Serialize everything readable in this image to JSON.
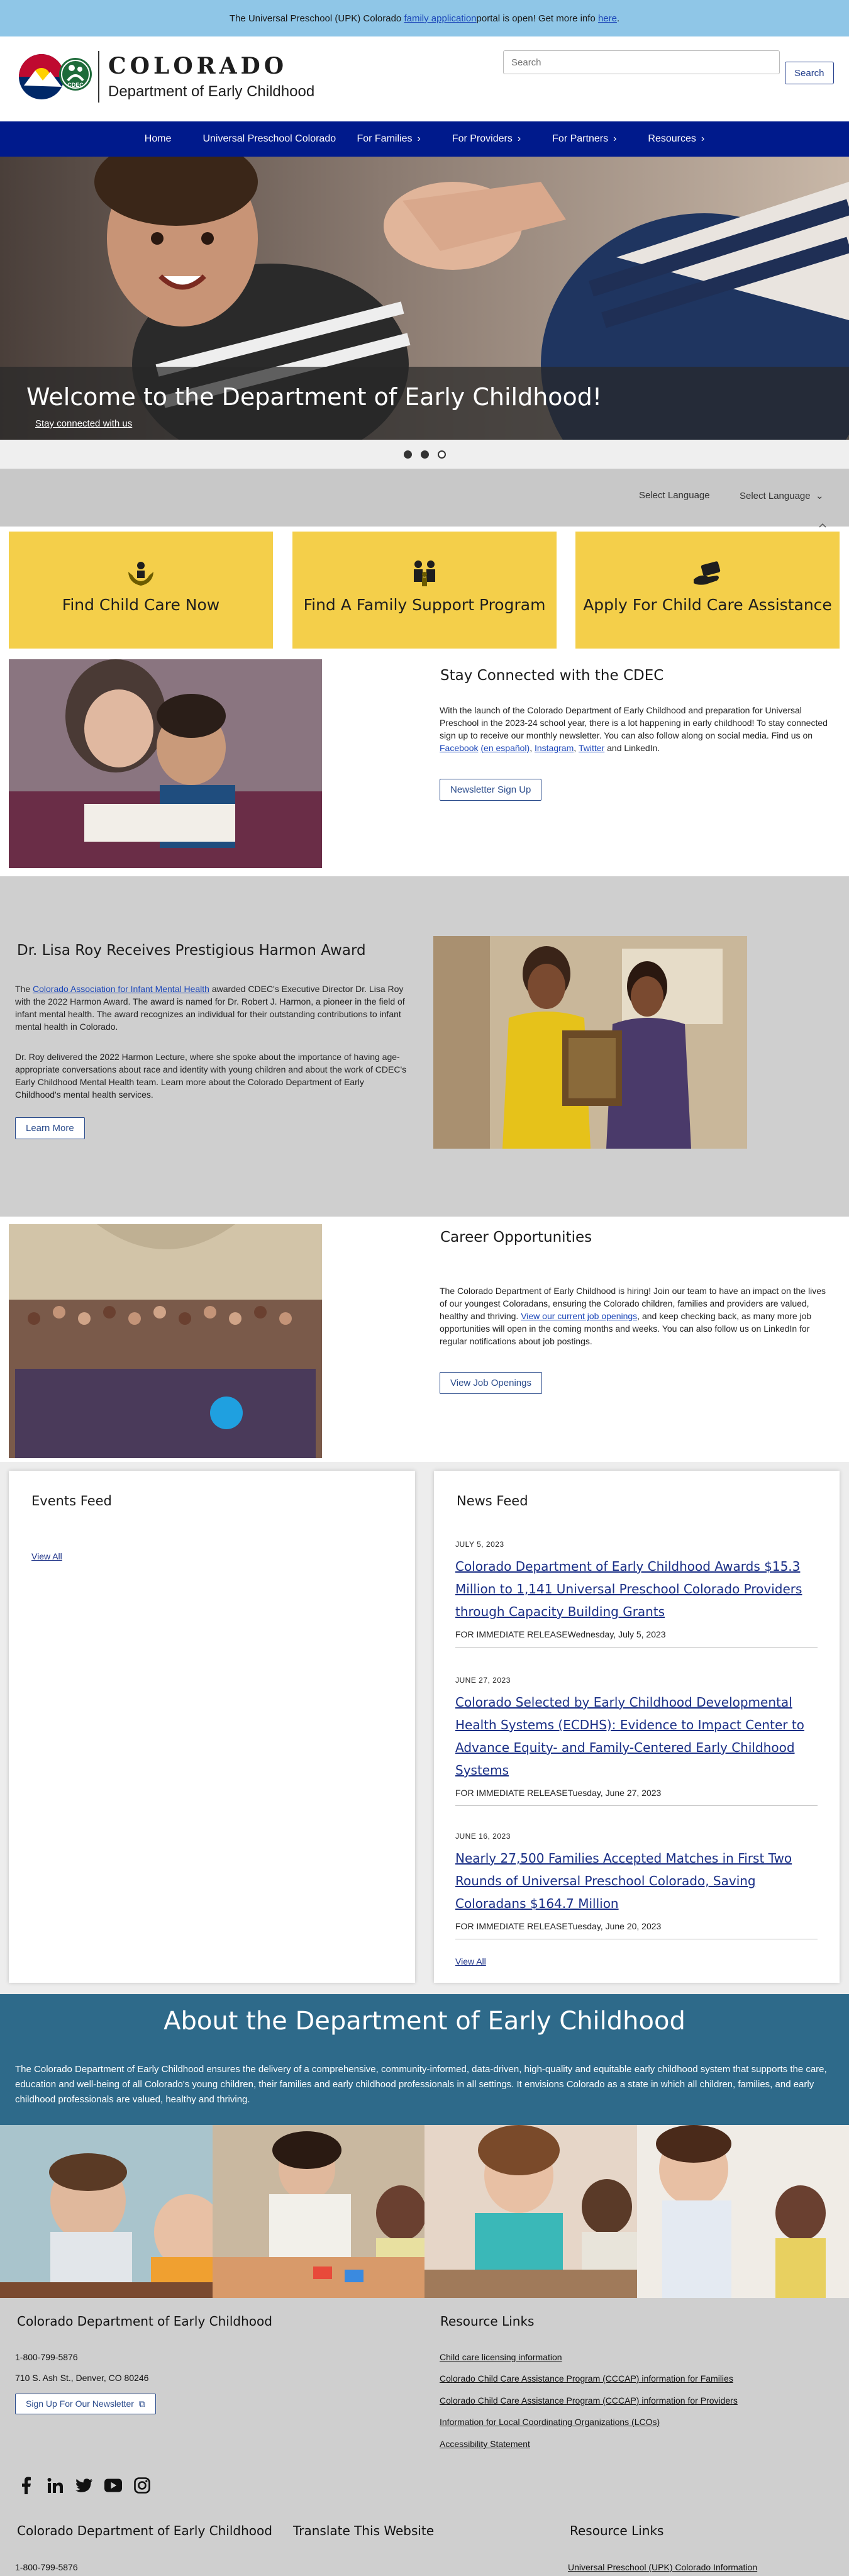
{
  "alert": {
    "prefix": "The Universal Preschool (UPK) Colorado ",
    "link": "family application",
    "middle": " portal is open! Get more info ",
    "link2": "here",
    "suffix": "."
  },
  "header": {
    "brand": "COLORADO",
    "department": "Department of Early Childhood",
    "logo_badge": "CDEC",
    "search_placeholder": "Search",
    "search_button": "Search"
  },
  "nav": {
    "items": [
      {
        "label": "Home",
        "has_menu": false
      },
      {
        "label": "Universal Preschool Colorado",
        "has_menu": false
      },
      {
        "label": "For Families",
        "has_menu": true
      },
      {
        "label": "For Providers",
        "has_menu": true
      },
      {
        "label": "For Partners",
        "has_menu": true
      },
      {
        "label": "Resources",
        "has_menu": true
      }
    ]
  },
  "hero": {
    "heading": "Welcome to the Department of Early Childhood!",
    "link": "Stay connected with us",
    "slides_total": 3,
    "active_slide": 2
  },
  "language": {
    "label": "Select Language",
    "select": "Select Language"
  },
  "cards": [
    {
      "title": "Find Child Care Now",
      "icon": "hands-child-icon"
    },
    {
      "title": "Find A Family Support Program",
      "icon": "family-icon"
    },
    {
      "title": "Apply For Child Care Assistance",
      "icon": "money-hand-icon"
    }
  ],
  "stay": {
    "heading": "Stay Connected with the CDEC",
    "body": "With the launch of the Colorado Department of Early Childhood and preparation for Universal Preschool in the 2023-24 school year, there is a lot happening in early childhood! To stay connected sign up to receive our monthly newsletter. You can also follow along on social media. Find us on ",
    "facebook": "Facebook",
    "espanol": "(en español)",
    "instagram": "Instagram",
    "twitter": "Twitter",
    "end": " and LinkedIn.",
    "button": "Newsletter Sign Up"
  },
  "award": {
    "heading": "Dr. Lisa Roy Receives Prestigious Harmon Award",
    "p1_pre": "The ",
    "p1_link": "Colorado Association for Infant Mental Health",
    "p1_post": " awarded CDEC's Executive Director Dr. Lisa Roy with the 2022 Harmon Award. The award is named for Dr. Robert J. Harmon, a pioneer in the field of infant mental health. The award recognizes an individual for their outstanding contributions to infant mental health in Colorado.",
    "p2": "Dr. Roy delivered the 2022 Harmon Lecture, where she spoke about the importance of having age-appropriate conversations about race and identity with young children and about the work of CDEC's Early Childhood Mental Health team. Learn more about the Colorado Department of Early Childhood's mental health services.",
    "button": "Learn More"
  },
  "career": {
    "heading": "Career Opportunities",
    "body_pre": "The Colorado Department of Early Childhood is hiring! Join our team to have an impact on the lives of our youngest Coloradans, ensuring the Colorado children, families and providers are valued, healthy and thriving. ",
    "body_link": "View our current job openings",
    "body_post": ", and keep checking back, as many more job opportunities will open in the coming months and weeks. You can also follow us on LinkedIn for regular notifications about job postings.",
    "button": "View Job Openings"
  },
  "events": {
    "heading": "Events Feed",
    "view_all": "View All"
  },
  "news": {
    "heading": "News Feed",
    "items": [
      {
        "date": "JULY 5, 2023",
        "title": "Colorado Department of Early Childhood Awards $15.3 Million to 1,141 Universal Preschool Colorado Providers through Capacity Building Grants",
        "meta": "FOR IMMEDIATE RELEASEWednesday, July 5, 2023"
      },
      {
        "date": "JUNE 27, 2023",
        "title": "Colorado Selected by Early Childhood Developmental Health Systems (ECDHS): Evidence to Impact Center to Advance Equity- and Family-Centered Early Childhood Systems",
        "meta": "FOR IMMEDIATE RELEASETuesday, June 27, 2023"
      },
      {
        "date": "JUNE 16, 2023",
        "title": "Nearly 27,500 Families Accepted Matches in First Two Rounds of Universal Preschool Colorado, Saving Coloradans $164.7 Million",
        "meta": "FOR IMMEDIATE RELEASETuesday, June 20, 2023"
      }
    ],
    "view_all": "View All"
  },
  "about": {
    "heading": "About the Department of Early Childhood",
    "body": "The Colorado Department of Early Childhood ensures the delivery of a comprehensive, community-informed, data-driven, high-quality and equitable early childhood system that supports the care, education and well-being of all Colorado's young children, their families and early childhood professionals in all settings. It envisions Colorado as a state in which all children, families, and early childhood professionals are valued, healthy and thriving."
  },
  "footer": {
    "org_heading": "Colorado Department of Early Childhood",
    "phone": "1-800-799-5876",
    "address": "710 S. Ash St., Denver, CO 80246",
    "newsletter_button": "Sign Up For Our Newsletter",
    "resources_heading": "Resource Links",
    "resource_links": [
      "Child care licensing information",
      "Colorado Child Care Assistance Program (CCCAP) information for Families",
      "Colorado Child Care Assistance Program (CCCAP) information for Providers",
      "Information for Local Coordinating Organizations (LCOs)",
      "Accessibility Statement"
    ],
    "social": [
      "facebook-icon",
      "linkedin-icon",
      "twitter-icon",
      "youtube-icon",
      "instagram-icon"
    ],
    "bottom": {
      "col1_heading": "Colorado Department of Early Childhood",
      "col1_phone": "1-800-799-5876",
      "col2_heading": "Translate This Website",
      "col3_heading": "Resource Links",
      "col3_link": "Universal Preschool (UPK) Colorado Information"
    }
  },
  "colors": {
    "alert_bg": "#8fc6e7",
    "nav_bg": "#001a8c",
    "card_bg": "#f4cf4a",
    "about_bg": "#2e6a8a",
    "link": "#1a45b8"
  }
}
